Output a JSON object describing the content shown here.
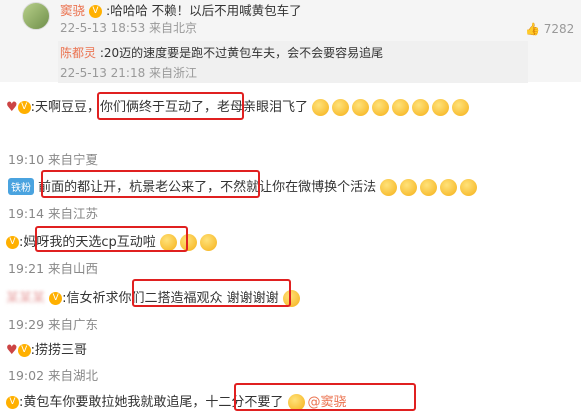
{
  "top": {
    "user": "窦骁",
    "text": ":哈哈哈 不赖！以后不用喊黄包车了",
    "time": "22-5-13 18:53 来自北京",
    "likes": "7282",
    "reply_user": "陈都灵",
    "reply_text": ":20迈的速度要是跑不过黄包车夫，会不会要容易追尾",
    "reply_time": "22-5-13 21:18 来自浙江"
  },
  "comments": [
    {
      "text": ":天啊豆豆，你们俩终于互动了，老母亲眼泪飞了",
      "meta": "19:10 来自宁夏"
    },
    {
      "badge": "铁粉",
      "text": "前面的都让开，杭景老公来了，不然就让你在微博换个活法",
      "meta": "19:14 来自江苏"
    },
    {
      "text": ":妈呀我的天选cp互动啦",
      "meta": "19:21 来自山西"
    },
    {
      "name_blur": "某某某",
      "text": ":信女祈求你们二搭造福观众 谢谢谢谢",
      "meta": "19:29 来自广东"
    },
    {
      "text": ":捞捞三哥",
      "meta": "19:02 来自湖北"
    },
    {
      "text": ":黄包车你要敢拉她我就敢追尾，十二分不要了",
      "mention": "@窦骁"
    }
  ],
  "icons": [
    "heart-icon",
    "verified-icon",
    "emoji-icon"
  ]
}
